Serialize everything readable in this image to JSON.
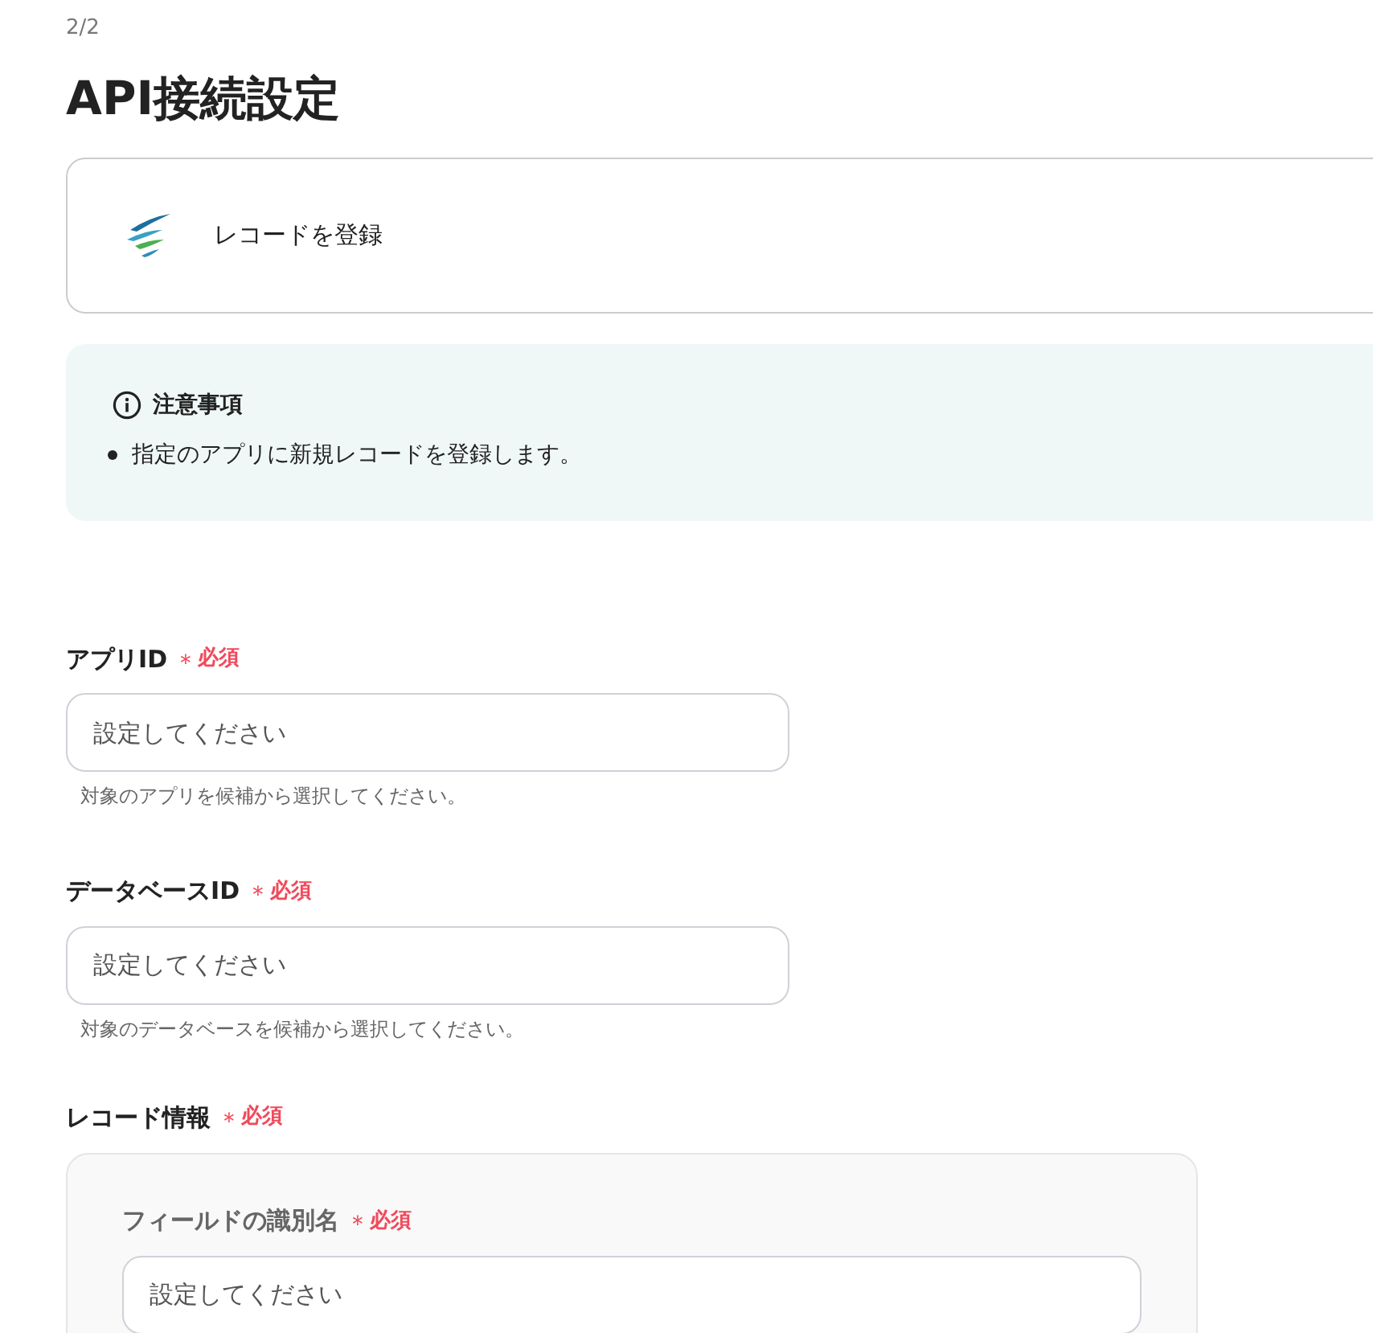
{
  "step": "2/2",
  "title": "API接続設定",
  "action": {
    "label": "レコードを登録"
  },
  "notice": {
    "heading": "注意事項",
    "items": [
      "指定のアプリに新規レコードを登録します。"
    ]
  },
  "fields": [
    {
      "label": "アプリID",
      "required_mark": "＊",
      "required_text": "必須",
      "placeholder": "設定してください",
      "help": "対象のアプリを候補から選択してください。"
    },
    {
      "label": "データベースID",
      "required_mark": "＊",
      "required_text": "必須",
      "placeholder": "設定してください",
      "help": "対象のデータベースを候補から選択してください。"
    }
  ],
  "record_info": {
    "label": "レコード情報",
    "required_mark": "＊",
    "required_text": "必須",
    "fields": [
      {
        "label": "フィールドの識別名",
        "required_mark": "＊",
        "required_text": "必須",
        "placeholder": "設定してください"
      }
    ]
  }
}
